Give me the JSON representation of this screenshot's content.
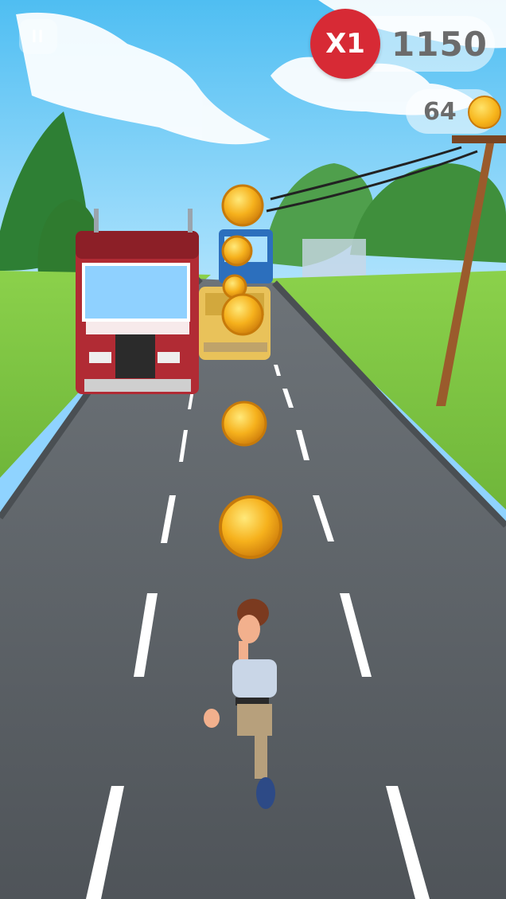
{
  "hud": {
    "pause_label": "II",
    "multiplier": "X1",
    "score": "1150",
    "coins": "64"
  },
  "icons": {
    "pause": "pause-icon",
    "coin": "coin-icon"
  },
  "colors": {
    "sky": "#8fd3ff",
    "grass": "#8bc63f",
    "road": "#5a5f64",
    "lane_marking": "#ffffff",
    "multiplier_badge": "#d72a35",
    "coin": "#f7b51b"
  }
}
